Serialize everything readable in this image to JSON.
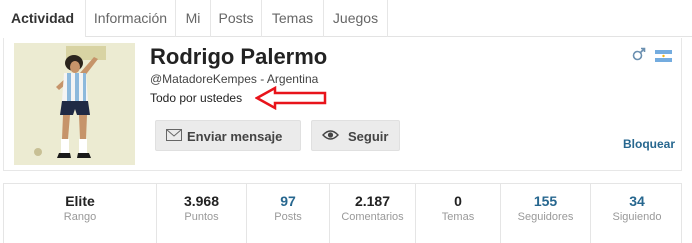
{
  "tabs": [
    {
      "label": "Actividad",
      "active": true
    },
    {
      "label": "Información",
      "active": false
    },
    {
      "label": "Mi",
      "active": false
    },
    {
      "label": "Posts",
      "active": false
    },
    {
      "label": "Temas",
      "active": false
    },
    {
      "label": "Juegos",
      "active": false
    }
  ],
  "profile": {
    "name": "Rodrigo Palermo",
    "handle": "@MatadoreKempes",
    "separator": " - ",
    "country": "Argentina",
    "tagline": "Todo por ustedes",
    "gender_icon": "male-icon",
    "flag_icon": "argentina-flag-icon",
    "buttons": {
      "message_label": "Enviar mensaje",
      "follow_label": "Seguir",
      "block_label": "Bloquear"
    }
  },
  "stats": [
    {
      "value": "Elite",
      "label": "Rango",
      "link": false
    },
    {
      "value": "3.968",
      "label": "Puntos",
      "link": false
    },
    {
      "value": "97",
      "label": "Posts",
      "link": true
    },
    {
      "value": "2.187",
      "label": "Comentarios",
      "link": false
    },
    {
      "value": "0",
      "label": "Temas",
      "link": false
    },
    {
      "value": "155",
      "label": "Seguidores",
      "link": true
    },
    {
      "value": "34",
      "label": "Siguiendo",
      "link": true
    }
  ],
  "colors": {
    "link": "#27678f",
    "arrow": "#e8141b",
    "flag_blue": "#74acdf"
  }
}
